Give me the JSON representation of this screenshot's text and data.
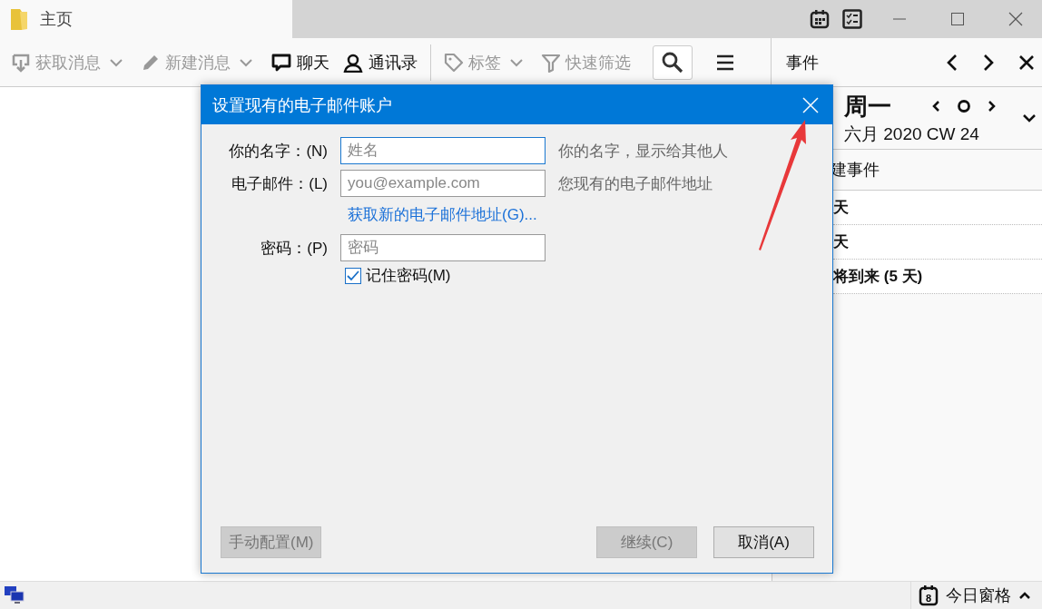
{
  "window": {
    "tab": "主页"
  },
  "toolbar": [
    {
      "label": "获取消息",
      "disabled": true,
      "dropdown": true
    },
    {
      "label": "新建消息",
      "disabled": true,
      "dropdown": true
    },
    {
      "label": "聊天",
      "disabled": false,
      "dropdown": false
    },
    {
      "label": "通讯录",
      "disabled": false,
      "dropdown": false
    },
    {
      "label": "标签",
      "disabled": true,
      "dropdown": true
    },
    {
      "label": "快速筛选",
      "disabled": true,
      "dropdown": false
    }
  ],
  "events_pane": {
    "title": "事件",
    "day": "周一",
    "month_line": "六月 2020  CW 24",
    "new_event": "建事件",
    "sections": [
      {
        "label": "天"
      },
      {
        "label": "天"
      },
      {
        "label": "将到来 (5 天)"
      }
    ]
  },
  "dialog": {
    "title": "设置现有的电子邮件账户",
    "fields": [
      {
        "label": "你的名字：(N)",
        "placeholder": "姓名",
        "hint": "你的名字，显示给其他人",
        "focused": true
      },
      {
        "label": "电子邮件：(L)",
        "placeholder": "you@example.com",
        "hint": "您现有的电子邮件地址",
        "focused": false
      },
      {
        "label": "密码：(P)",
        "placeholder": "密码",
        "focused": false
      }
    ],
    "link": "获取新的电子邮件地址(G)...",
    "remember": {
      "label": "记住密码(M)",
      "checked": true
    },
    "buttons": [
      {
        "label": "手动配置(M)",
        "disabled": true,
        "kind": "left"
      },
      {
        "label": "继续(C)",
        "disabled": true,
        "kind": "right"
      },
      {
        "label": "取消(A)",
        "disabled": false,
        "kind": "right"
      }
    ]
  },
  "status_bar": {
    "today_pane": "今日窗格",
    "today_day": "8"
  }
}
